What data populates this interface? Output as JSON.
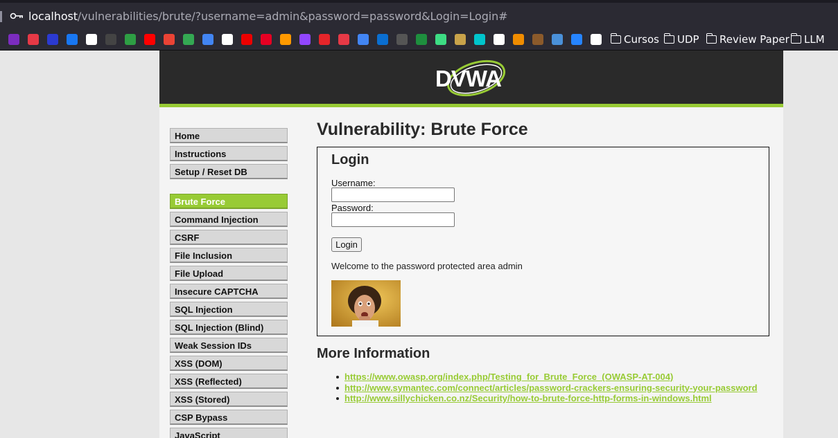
{
  "browser": {
    "url_host": "localhost",
    "url_path": "/vulnerabilities/brute/?username=admin&password=password&Login=Login#",
    "bookmark_icons": [
      "mastodon-icon",
      "star-icon",
      "disney-icon",
      "meta-icon",
      "grid-icon",
      "appletv-icon",
      "play-icon",
      "youtube-music-icon",
      "gmail-icon",
      "drive-icon",
      "translate-icon",
      "wordreference-icon",
      "santander-icon",
      "pinterest-icon",
      "amazon-icon",
      "twitch-icon",
      "symbolab-icon",
      "heart-icon",
      "calendar-icon",
      "sap-icon",
      "globe-icon",
      "classroom-icon",
      "leaf-icon",
      "pyramid-icon",
      "canva-icon",
      "github-icon",
      "infinity-icon",
      "image-icon",
      "graduation-icon",
      "jira-icon",
      "notion-icon"
    ],
    "bookmark_colors": [
      "#7b2cbf",
      "#e63946",
      "#2b3ad1",
      "#1877f2",
      "#ffffff",
      "#444444",
      "#2e9e44",
      "#ff0000",
      "#ea4335",
      "#34a853",
      "#4285f4",
      "#ffffff",
      "#ec0000",
      "#e60023",
      "#ff9900",
      "#9146ff",
      "#e5252a",
      "#e63946",
      "#4285f4",
      "#0a6ed1",
      "#555555",
      "#1e8e3e",
      "#3ddc84",
      "#c8a24a",
      "#00c4cc",
      "#ffffff",
      "#f08c00",
      "#8b5a2b",
      "#4a90d9",
      "#2684ff",
      "#ffffff"
    ],
    "folders": [
      "Cursos",
      "UDP",
      "Review Paper",
      "LLM"
    ]
  },
  "logo_text": "DVWA",
  "menu": {
    "group1": [
      "Home",
      "Instructions",
      "Setup / Reset DB"
    ],
    "group2": [
      "Brute Force",
      "Command Injection",
      "CSRF",
      "File Inclusion",
      "File Upload",
      "Insecure CAPTCHA",
      "SQL Injection",
      "SQL Injection (Blind)",
      "Weak Session IDs",
      "XSS (DOM)",
      "XSS (Reflected)",
      "XSS (Stored)",
      "CSP Bypass",
      "JavaScript"
    ],
    "active": "Brute Force"
  },
  "main": {
    "title": "Vulnerability: Brute Force",
    "login_heading": "Login",
    "username_label": "Username:",
    "username_value": "",
    "password_label": "Password:",
    "password_value": "",
    "login_button": "Login",
    "welcome": "Welcome to the password protected area admin",
    "more_heading": "More Information",
    "links": [
      "https://www.owasp.org/index.php/Testing_for_Brute_Force_(OWASP-AT-004)",
      "http://www.symantec.com/connect/articles/password-crackers-ensuring-security-your-password",
      "http://www.sillychicken.co.nz/Security/how-to-brute-force-http-forms-in-windows.html"
    ]
  },
  "colors": {
    "accent": "#98cb35",
    "header": "#2a2a2a"
  }
}
